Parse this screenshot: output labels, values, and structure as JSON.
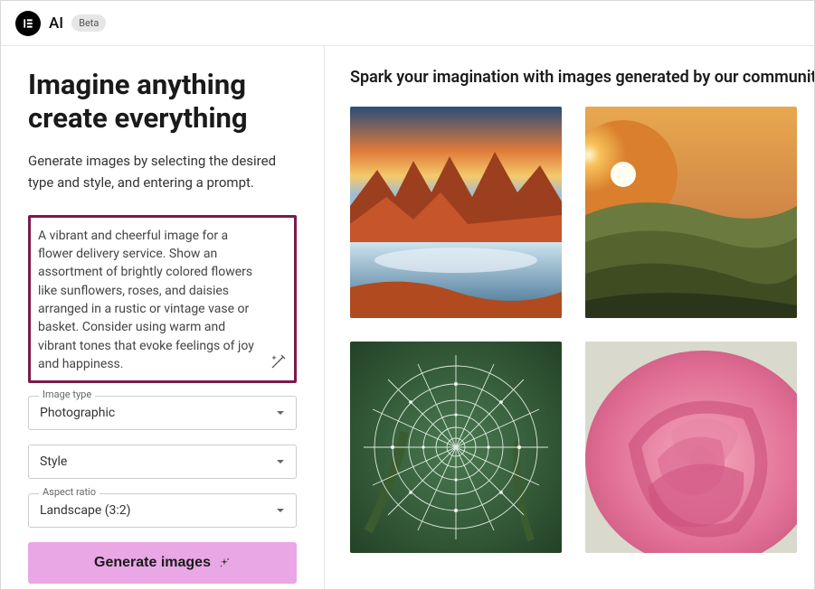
{
  "header": {
    "brand": "AI",
    "badge": "Beta"
  },
  "sidebar": {
    "title_line1": "Imagine anything",
    "title_line2": "create everything",
    "subtitle": "Generate images by selecting the desired type and style, and entering a prompt.",
    "prompt_value": "A vibrant and cheerful image for a flower delivery service. Show an assortment of brightly colored flowers like sunflowers, roses, and daisies arranged in a rustic or vintage vase or basket. Consider using warm and vibrant tones that evoke feelings of joy and happiness.",
    "image_type_label": "Image type",
    "image_type_value": "Photographic",
    "style_label": "Style",
    "style_value": "",
    "aspect_label": "Aspect ratio",
    "aspect_value": "Landscape (3:2)",
    "generate_label": "Generate images"
  },
  "main": {
    "heading": "Spark your imagination with images generated by our community"
  },
  "colors": {
    "highlight_border": "#7b1a4a",
    "generate_bg": "#e9a7e6"
  }
}
